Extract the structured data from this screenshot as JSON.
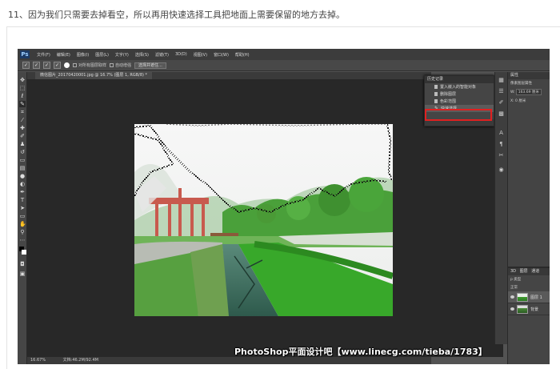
{
  "article": {
    "step_text": "11、因为我们只需要去掉看空，所以再用快速选择工具把地面上需要保留的地方去掉。"
  },
  "photoshop": {
    "logo": "Ps",
    "menus": [
      "文件(F)",
      "编辑(E)",
      "图像(I)",
      "图层(L)",
      "文字(Y)",
      "选择(S)",
      "滤镜(T)",
      "3D(D)",
      "视图(V)",
      "窗口(W)",
      "帮助(H)"
    ],
    "options": {
      "sample_all_layers": "对所有图层取样",
      "auto_enhance": "自动增强",
      "refine_edge": "选择并遮住..."
    },
    "document_tab": "微信图片_20170420001.jpg @ 16.7% (图层 1, RGB/8) *",
    "status": {
      "zoom": "16.67%",
      "doc_size": "文档:46.2M/92.4M"
    },
    "history": {
      "title": "历史记录",
      "items": [
        {
          "label": "置入嵌入的智能对象",
          "icon": "history-state-icon"
        },
        {
          "label": "删除图层",
          "icon": "history-state-icon"
        },
        {
          "label": "色彩范围",
          "icon": "history-state-icon"
        },
        {
          "label": "快速选择",
          "icon": "quick-selection-icon",
          "selected": true
        }
      ]
    },
    "properties": {
      "title": "属性",
      "subtitle": "像素图层属性",
      "w_label": "W:",
      "w_value": "163.69 厘米",
      "x_label": "X: 0 厘米"
    },
    "layers": {
      "tabs": [
        "3D",
        "图层",
        "通道"
      ],
      "kind": "p 类型",
      "blend": "正常",
      "rows": [
        {
          "name": "图层 1",
          "selected": true
        },
        {
          "name": "背景",
          "selected": false
        }
      ]
    }
  },
  "watermark": "PhotoShop平面设计吧【www.linecg.com/tieba/1783】",
  "colors": {
    "highlight_box": "#e02020",
    "ps_bg": "#535353",
    "canvas_bg": "#282828"
  }
}
